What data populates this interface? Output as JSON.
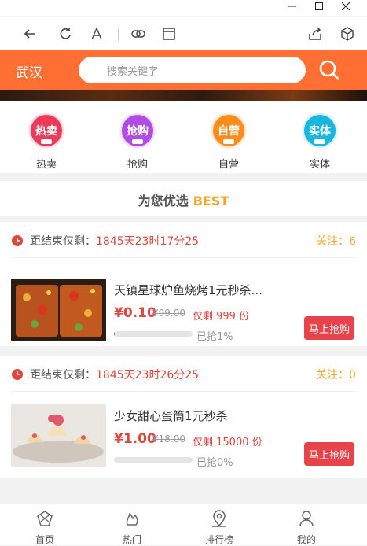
{
  "window": {
    "minimize_icon": "minimize-icon",
    "maximize_icon": "maximize-icon",
    "close_icon": "close-icon"
  },
  "browser": {
    "icons": [
      "back-arrow-icon",
      "refresh-icon",
      "font-size-icon",
      "link-icon",
      "window-icon",
      "share-icon",
      "cube-icon"
    ]
  },
  "header": {
    "city": "武汉",
    "search_placeholder": "搜索关键字",
    "accent": "#ff6f33"
  },
  "categories": [
    {
      "label": "热卖",
      "badge": "热卖",
      "color": "#ee3a5a"
    },
    {
      "label": "抢购",
      "badge": "抢购",
      "color": "#b24be6"
    },
    {
      "label": "自营",
      "badge": "自营",
      "color": "#ff8c1a"
    },
    {
      "label": "实体",
      "badge": "实体",
      "color": "#19b6e0"
    }
  ],
  "section": {
    "title": "为您优选",
    "title_en": "BEST"
  },
  "products": [
    {
      "countdown_label": "距结束仅剩：",
      "countdown": "1845天23时17分25",
      "follow": "关注：6",
      "title": "天镇星球炉鱼烧烤1元秒杀...",
      "price": "¥0.10",
      "old_price": "¥99.00",
      "stock": "仅剩 999 份",
      "progress_percent": 1,
      "sold": "已抢1%",
      "buy_label": "马上抢购"
    },
    {
      "countdown_label": "距结束仅剩：",
      "countdown": "1845天23时26分25",
      "follow": "关注：0",
      "title": "少女甜心蛋筒1元秒杀",
      "price": "¥1.00",
      "old_price": "¥18.00",
      "stock": "仅剩 15000 份",
      "progress_percent": 0,
      "sold": "已抢0%",
      "buy_label": "马上抢购"
    }
  ],
  "tabs": [
    {
      "label": "首页",
      "icon": "home-icon"
    },
    {
      "label": "热门",
      "icon": "hot-icon"
    },
    {
      "label": "排行榜",
      "icon": "location-pin-icon"
    },
    {
      "label": "我的",
      "icon": "user-icon"
    }
  ]
}
